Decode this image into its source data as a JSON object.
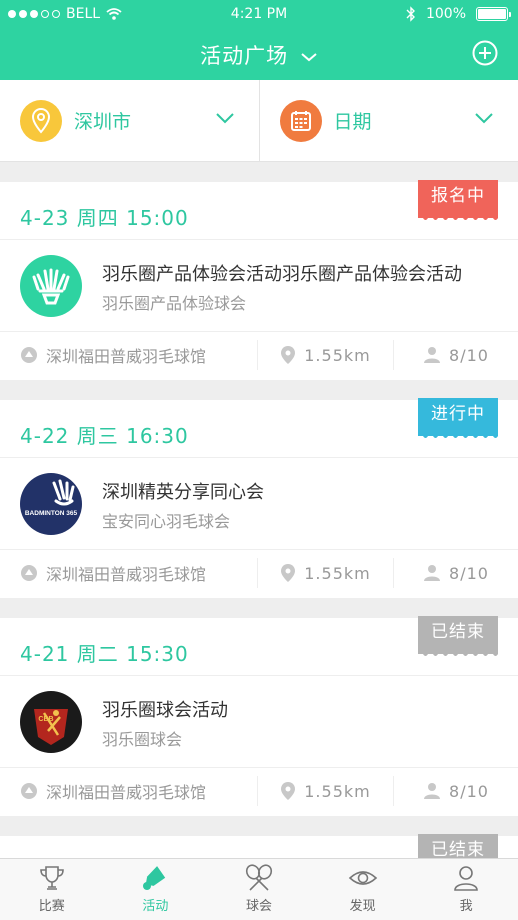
{
  "status_bar": {
    "carrier": "BELL",
    "time": "4:21 PM",
    "battery": "100%"
  },
  "nav": {
    "title": "活动广场"
  },
  "filters": {
    "city": "深圳市",
    "date": "日期"
  },
  "colors": {
    "brand": "#2ed3a1",
    "accent": "#2ec7a0",
    "registering": "#f0645a",
    "ongoing": "#35b9dc",
    "ended": "#b4b4b4"
  },
  "events": [
    {
      "date": "4-23 周四 15:00",
      "status": "报名中",
      "name": "羽乐圈产品体验会活动羽乐圈产品体验会活动",
      "club": "羽乐圈产品体验球会",
      "venue": "深圳福田普威羽毛球馆",
      "distance": "1.55km",
      "count": "8/10"
    },
    {
      "date": "4-22 周三 16:30",
      "status": "进行中",
      "name": "深圳精英分享同心会",
      "club": "宝安同心羽毛球会",
      "venue": "深圳福田普威羽毛球馆",
      "distance": "1.55km",
      "count": "8/10",
      "logo_text": "BADMINTON 365"
    },
    {
      "date": "4-21 周二 15:30",
      "status": "已结束",
      "name": "羽乐圈球会活动",
      "club": "羽乐圈球会",
      "venue": "深圳福田普威羽毛球馆",
      "distance": "1.55km",
      "count": "8/10",
      "logo_text": "CBB"
    },
    {
      "date": "",
      "status": "已结束"
    }
  ],
  "tabs": [
    {
      "label": "比赛",
      "icon": "trophy-icon"
    },
    {
      "label": "活动",
      "icon": "shuttlecock-icon",
      "active": true
    },
    {
      "label": "球会",
      "icon": "rackets-icon"
    },
    {
      "label": "发现",
      "icon": "eye-icon"
    },
    {
      "label": "我",
      "icon": "person-icon"
    }
  ]
}
